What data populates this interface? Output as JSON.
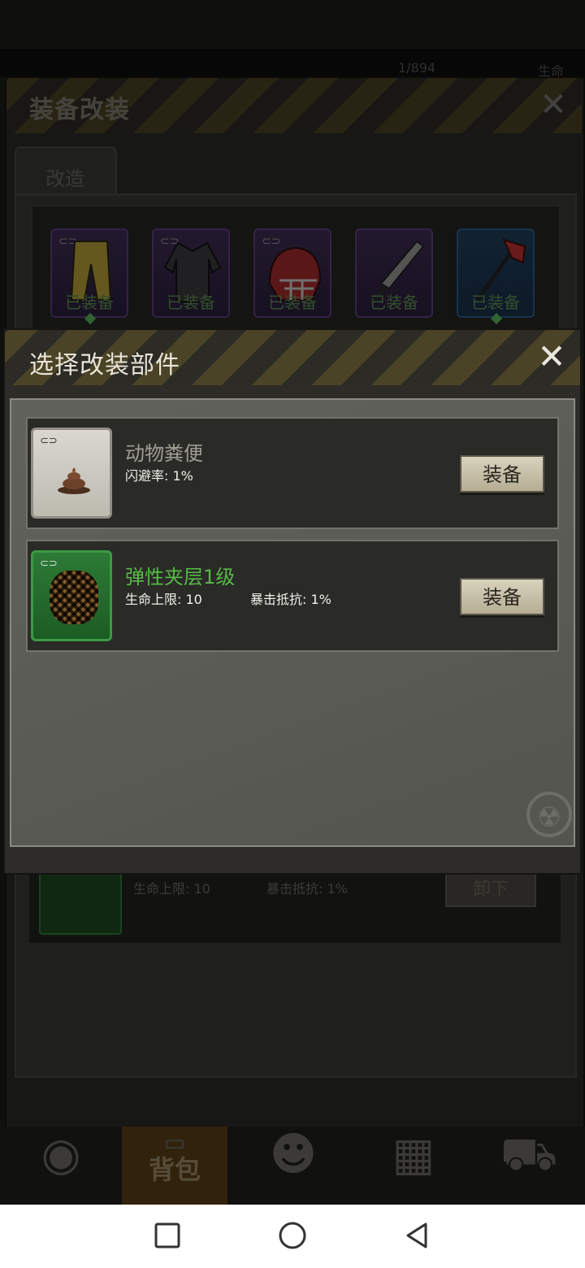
{
  "status_partial": {
    "count": "1/894",
    "label": "生命"
  },
  "back_panel": {
    "title": "装备改装",
    "tab_label": "改造",
    "slots": [
      {
        "label": "已装备",
        "kind": "pants-icon",
        "rarity": "purple"
      },
      {
        "label": "已装备",
        "kind": "jacket-icon",
        "rarity": "purple"
      },
      {
        "label": "已装备",
        "kind": "helmet-icon",
        "rarity": "purple"
      },
      {
        "label": "已装备",
        "kind": "blade-icon",
        "rarity": "purple"
      },
      {
        "label": "已装备",
        "kind": "axe-icon",
        "rarity": "blue"
      }
    ],
    "equipped_row": {
      "stat1": "生命上限: 10",
      "stat2": "暴击抵抗: 1%",
      "button_label": "卸下"
    }
  },
  "dialog": {
    "title": "选择改装部件",
    "items": [
      {
        "name": "动物粪便",
        "stat1": "闪避率: 1%",
        "stat2": "",
        "button_label": "装备",
        "color": "#a09d94"
      },
      {
        "name": "弹性夹层1级",
        "stat1": "生命上限: 10",
        "stat2": "暴击抵抗: 1%",
        "button_label": "装备",
        "color": "#57b947"
      }
    ]
  },
  "bottom_nav": {
    "items": [
      {
        "icon": "globe-icon",
        "label": ""
      },
      {
        "icon": "backpack-icon",
        "label": "背包",
        "active": true
      },
      {
        "icon": "head-gear-icon",
        "label": ""
      },
      {
        "icon": "calculator-icon",
        "label": ""
      },
      {
        "icon": "cart-icon",
        "label": ""
      }
    ]
  }
}
